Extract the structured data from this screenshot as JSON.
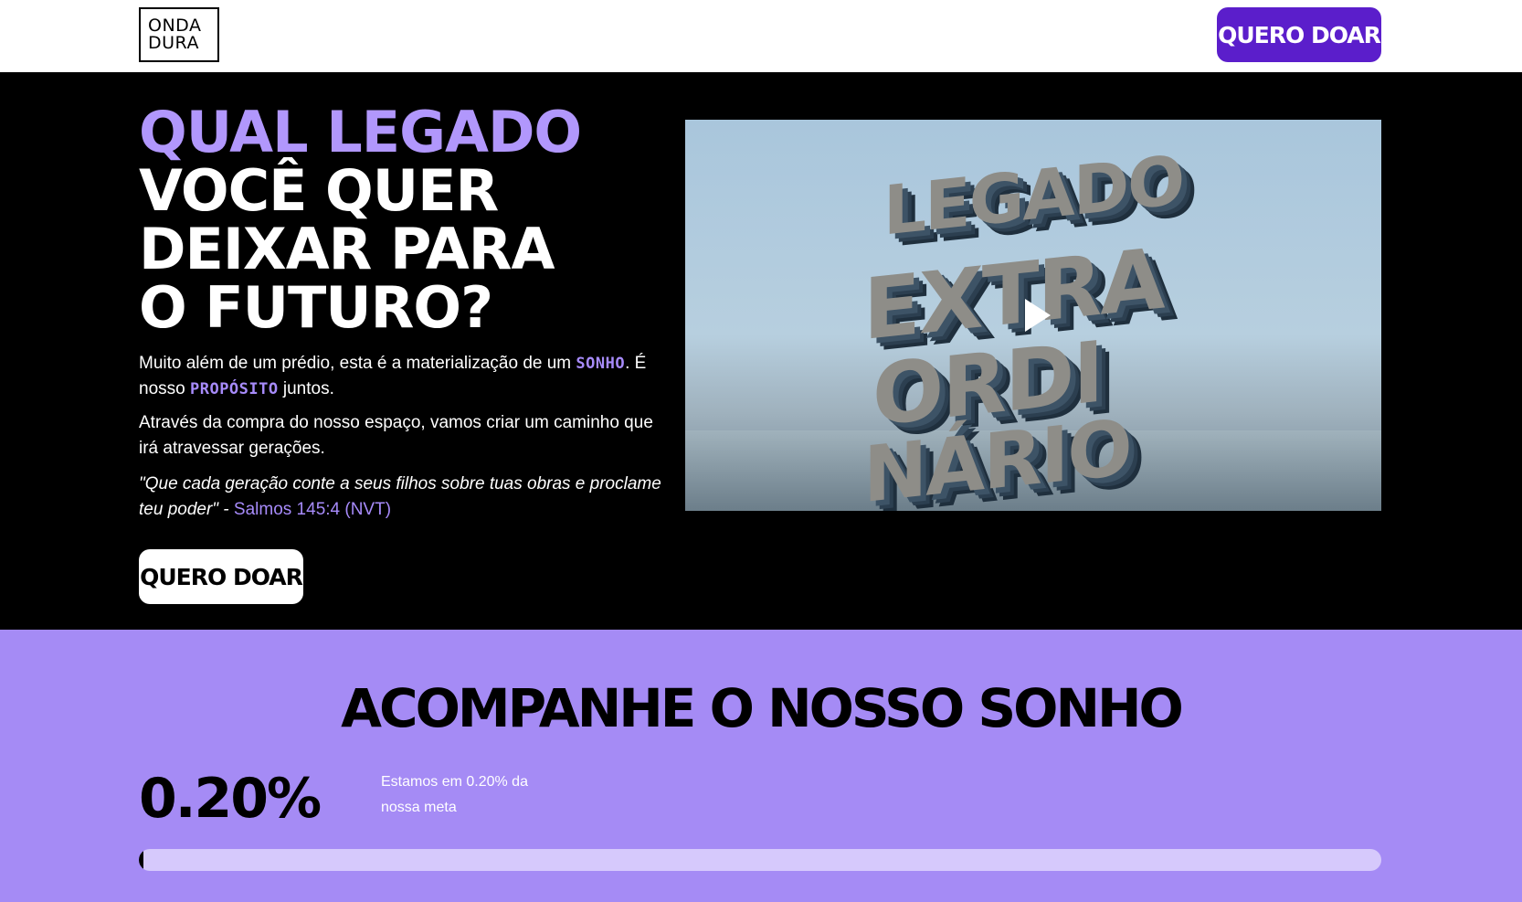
{
  "header": {
    "logo_line1": "ONDA",
    "logo_line2": "DURA",
    "cta_label": "QUERO DOAR"
  },
  "hero": {
    "headline_line1": "QUAL LEGADO",
    "headline_line2": "VOCÊ QUER",
    "headline_line3": "DEIXAR PARA",
    "headline_line4": "O FUTURO?",
    "p1_before": "Muito além de um prédio, esta é a materialização de um ",
    "p1_highlight1": "SONHO",
    "p1_middle": ". É nosso ",
    "p1_highlight2": "PROPÓSITO",
    "p1_after": " juntos.",
    "p2": "Através da compra do nosso espaço, vamos criar um caminho que irá atravessar gerações.",
    "quote_text": "\"Que cada geração conte a seus filhos sobre tuas obras e proclame teu poder\"",
    "quote_dash": " - ",
    "quote_ref": "Salmos 145:4 (NVT)",
    "cta_label": "QUERO DOAR",
    "video": {
      "word1": "LEGADO",
      "word2": "EXTRA",
      "word3": "ORDI",
      "word4": "NÁRIO",
      "play_icon": "play-icon"
    }
  },
  "progress": {
    "title": "ACOMPANHE O NOSSO SONHO",
    "percent_label": "0.20%",
    "note": "Estamos em 0.20% da nossa meta",
    "value_fraction": 0.002
  },
  "colors": {
    "accent_purple": "#a78bfa",
    "button_purple": "#5b1ecb",
    "section_purple": "#a58bf5",
    "bar_track": "#d6c9fc"
  }
}
